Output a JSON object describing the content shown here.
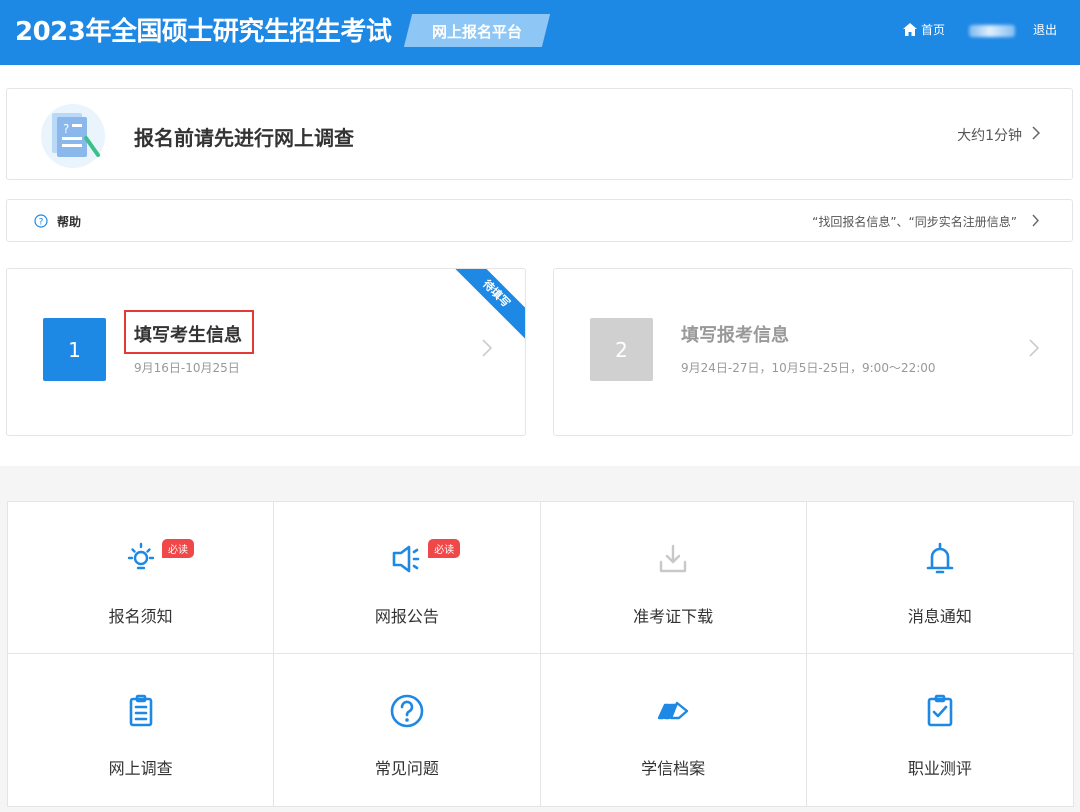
{
  "header": {
    "title": "2023年全国硕士研究生招生考试",
    "platform": "网上报名平台",
    "home_label": "首页",
    "logout_label": "退出"
  },
  "survey": {
    "text": "报名前请先进行网上调查",
    "hint": "大约1分钟"
  },
  "help": {
    "label": "帮助",
    "hint": "“找回报名信息”、“同步实名注册信息”"
  },
  "steps": [
    {
      "number": "1",
      "title": "填写考生信息",
      "date": "9月16日-10月25日",
      "ribbon": "待填写"
    },
    {
      "number": "2",
      "title": "填写报考信息",
      "date": "9月24日-27日，10月5日-25日，9:00～22:00"
    }
  ],
  "tiles": [
    {
      "label": "报名须知",
      "icon": "lightbulb-icon",
      "badge": "必读"
    },
    {
      "label": "网报公告",
      "icon": "megaphone-icon",
      "badge": "必读"
    },
    {
      "label": "准考证下载",
      "icon": "download-icon"
    },
    {
      "label": "消息通知",
      "icon": "bell-icon"
    },
    {
      "label": "网上调查",
      "icon": "clipboard-list-icon"
    },
    {
      "label": "常见问题",
      "icon": "question-circle-icon"
    },
    {
      "label": "学信档案",
      "icon": "archive-icon"
    },
    {
      "label": "职业测评",
      "icon": "clipboard-check-icon"
    }
  ],
  "colors": {
    "primary": "#1e88e5",
    "badge": "#f04848",
    "highlight_box": "#e53935",
    "disabled": "#d0d0d0"
  }
}
